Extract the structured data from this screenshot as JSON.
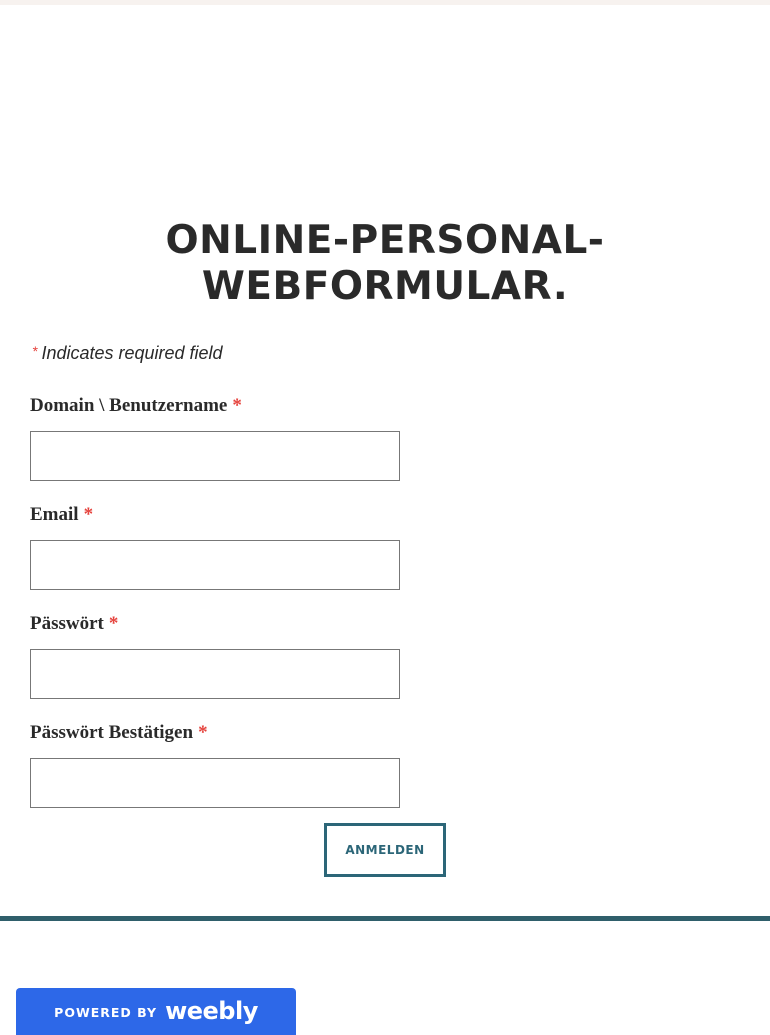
{
  "page": {
    "title_line1": "ONLINE-PERSONAL-",
    "title_line2": "WEBFORMULAR."
  },
  "form": {
    "required_note": {
      "star": "*",
      "text": "Indicates required field"
    },
    "required_marker": "*",
    "fields": [
      {
        "label": "Domain \\ Benutzername",
        "value": "",
        "placeholder": ""
      },
      {
        "label": "Email",
        "value": "",
        "placeholder": ""
      },
      {
        "label": "Pässwört",
        "value": "",
        "placeholder": ""
      },
      {
        "label": "Pässwört Bestätigen",
        "value": "",
        "placeholder": ""
      }
    ],
    "submit_label": "ANMELDEN"
  },
  "footer": {
    "badge_powered": "POWERED BY",
    "badge_brand": "weebly"
  },
  "colors": {
    "accent": "#2c6678",
    "required": "#e5413b",
    "badge": "#2d68e8",
    "divider": "#2f5f6b"
  }
}
